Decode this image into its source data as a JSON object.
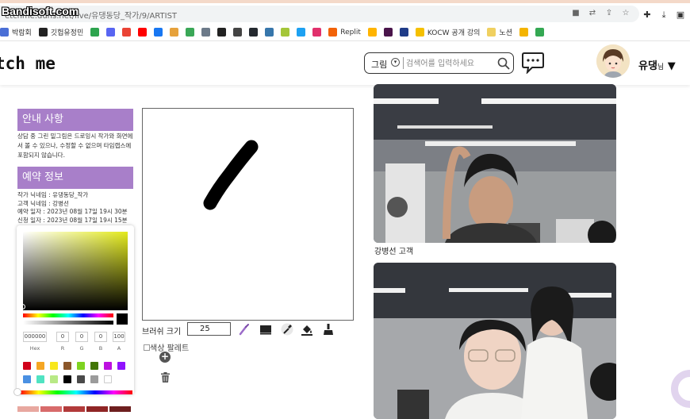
{
  "browser": {
    "url": "etchme.duns.net/live/유댕동당_작가/9/ARTIST",
    "watermark": "Bandisoft.com"
  },
  "bookmarks": [
    {
      "label": "박람회",
      "color": "#4a6fd6"
    },
    {
      "label": "깃헙유정민",
      "color": "#222222"
    },
    {
      "label": "",
      "color": "#2da44e"
    },
    {
      "label": "",
      "color": "#5865f2"
    },
    {
      "label": "",
      "color": "#ea4335"
    },
    {
      "label": "",
      "color": "#ff0000"
    },
    {
      "label": "",
      "color": "#1877f2"
    },
    {
      "label": "",
      "color": "#e6a23c"
    },
    {
      "label": "",
      "color": "#3aa757"
    },
    {
      "label": "",
      "color": "#6c7a89"
    },
    {
      "label": "",
      "color": "#222222"
    },
    {
      "label": "",
      "color": "#444444"
    },
    {
      "label": "",
      "color": "#24292f"
    },
    {
      "label": "",
      "color": "#3776ab"
    },
    {
      "label": "",
      "color": "#a4c639"
    },
    {
      "label": "",
      "color": "#1da1f2"
    },
    {
      "label": "",
      "color": "#e1306c"
    },
    {
      "label": "Replit",
      "color": "#f26207"
    },
    {
      "label": "",
      "color": "#ffb400"
    },
    {
      "label": "",
      "color": "#4a154b"
    },
    {
      "label": "",
      "color": "#1f3c88"
    },
    {
      "label": "KOCW 공개 강의",
      "color": "#f5c000"
    },
    {
      "label": "노션",
      "color": "#f0d060"
    },
    {
      "label": "",
      "color": "#f4b400"
    },
    {
      "label": "",
      "color": "#34a853"
    }
  ],
  "header": {
    "logo": "tch me",
    "search_category": "그림",
    "search_placeholder": "검색어를 입력하세요",
    "username": "유댕",
    "username_suffix": "님",
    "dropdown_arrow": "▼"
  },
  "notice": {
    "title": "안내 사항",
    "text": "상담 중 그린 밑그림은 드로잉시 작가와 화면에서 볼 수 있으나, 수정할 수 없으며 타임랩스에 포함되지 않습니다."
  },
  "booking": {
    "title": "예약 정보",
    "lines": [
      "작가 닉네임 : 유댕동당_작가",
      "고객 닉네임 : 강병선",
      "예약 일자 : 2023년 08월 17일 19시 30분",
      "신청 일자 : 2023년 08월 17일 19시 15분"
    ]
  },
  "color_picker": {
    "hex": "000000",
    "r": "0",
    "g": "0",
    "b": "0",
    "a": "100",
    "labels": [
      "Hex",
      "R",
      "G",
      "B",
      "A"
    ],
    "current_color": "#000000",
    "swatches": [
      "#d0021b",
      "#f5a623",
      "#f8e71c",
      "#8b572a",
      "#7ed321",
      "#417505",
      "#bd10e0",
      "#9013fe",
      "#4a90e2",
      "#50e3c2",
      "#b8e986",
      "#000000",
      "#4a4a4a",
      "#9b9b9b",
      "#ffffff"
    ],
    "bottom_swatches": [
      "#e8a8a0",
      "#d86b6b",
      "#b23a3a",
      "#8f2525",
      "#6e1f1f"
    ]
  },
  "drawing": {
    "brush_label": "브러쉬 크기",
    "brush_size": "25",
    "palette_alt": "색상 팔레트"
  },
  "video": {
    "customer_label": "강병선 고객"
  }
}
